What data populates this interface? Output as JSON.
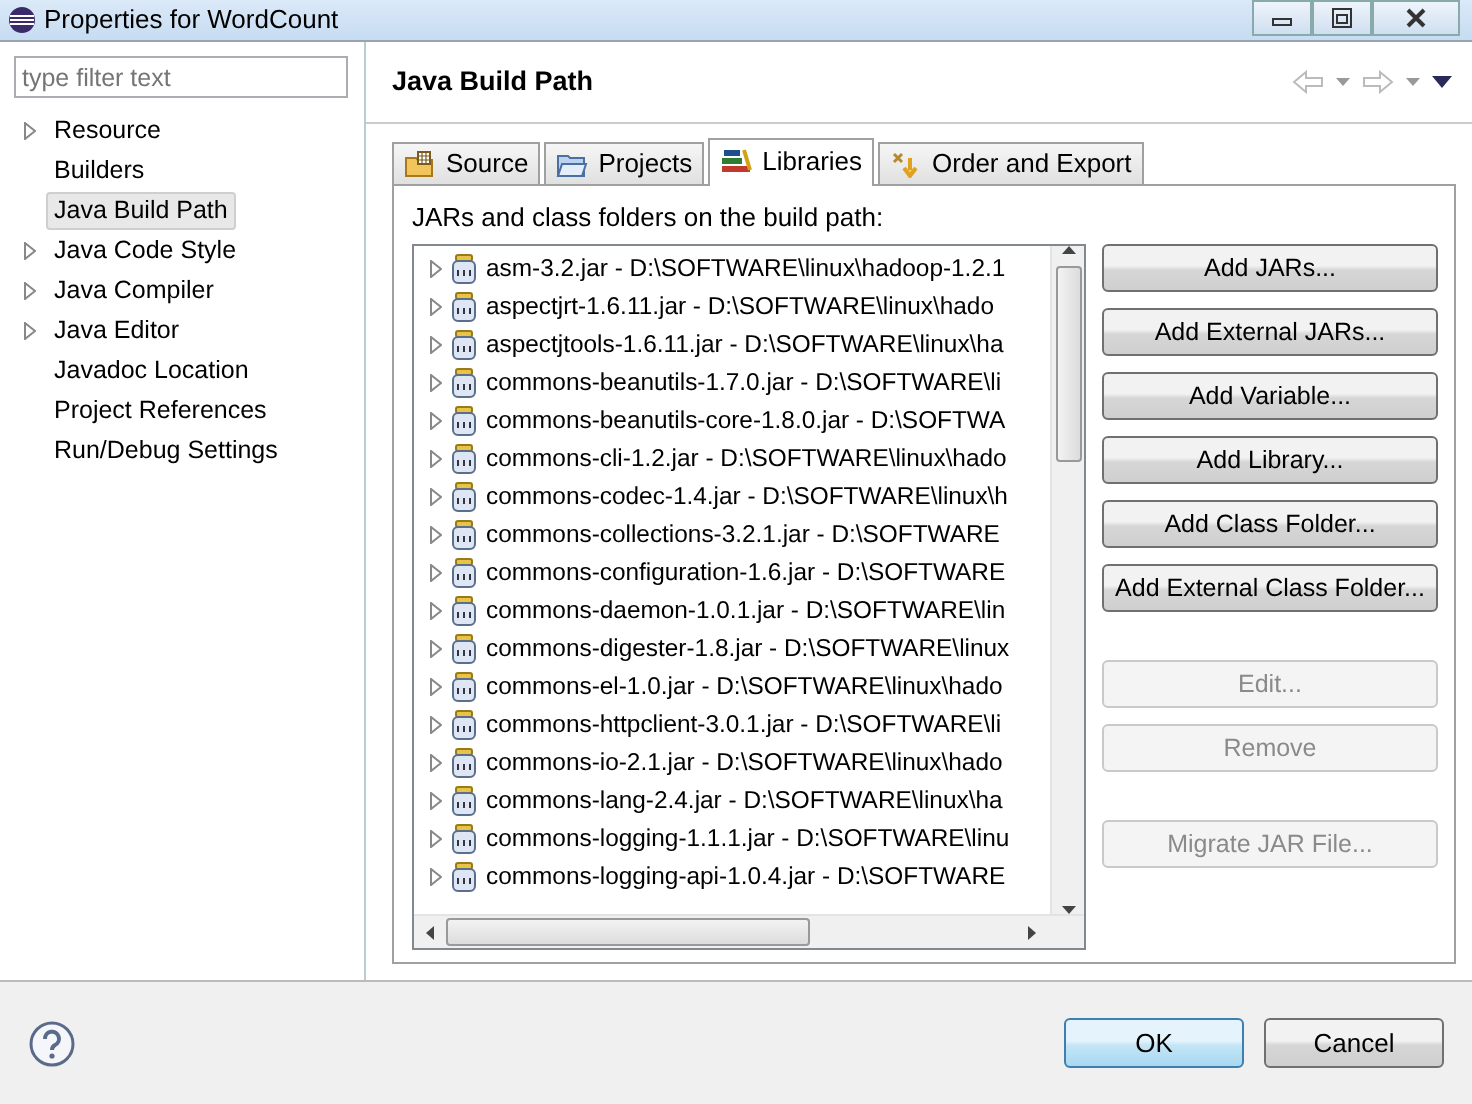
{
  "window": {
    "title": "Properties for WordCount"
  },
  "filter": {
    "placeholder": "type filter text"
  },
  "sidebar": {
    "items": [
      {
        "label": "Resource",
        "expandable": true,
        "selected": false
      },
      {
        "label": "Builders",
        "expandable": false,
        "selected": false
      },
      {
        "label": "Java Build Path",
        "expandable": false,
        "selected": true
      },
      {
        "label": "Java Code Style",
        "expandable": true,
        "selected": false
      },
      {
        "label": "Java Compiler",
        "expandable": true,
        "selected": false
      },
      {
        "label": "Java Editor",
        "expandable": true,
        "selected": false
      },
      {
        "label": "Javadoc Location",
        "expandable": false,
        "selected": false
      },
      {
        "label": "Project References",
        "expandable": false,
        "selected": false
      },
      {
        "label": "Run/Debug Settings",
        "expandable": false,
        "selected": false
      }
    ]
  },
  "page": {
    "title": "Java Build Path"
  },
  "tabs": [
    {
      "label": "Source",
      "kind": "source",
      "selected": false
    },
    {
      "label": "Projects",
      "kind": "projects",
      "selected": false
    },
    {
      "label": "Libraries",
      "kind": "libraries",
      "selected": true
    },
    {
      "label": "Order and Export",
      "kind": "order",
      "selected": false
    }
  ],
  "libraries": {
    "caption": "JARs and class folders on the build path:",
    "items": [
      "asm-3.2.jar - D:\\SOFTWARE\\linux\\hadoop-1.2.1",
      "aspectjrt-1.6.11.jar - D:\\SOFTWARE\\linux\\hado",
      "aspectjtools-1.6.11.jar - D:\\SOFTWARE\\linux\\ha",
      "commons-beanutils-1.7.0.jar - D:\\SOFTWARE\\li",
      "commons-beanutils-core-1.8.0.jar - D:\\SOFTWA",
      "commons-cli-1.2.jar - D:\\SOFTWARE\\linux\\hado",
      "commons-codec-1.4.jar - D:\\SOFTWARE\\linux\\h",
      "commons-collections-3.2.1.jar - D:\\SOFTWARE",
      "commons-configuration-1.6.jar - D:\\SOFTWARE",
      "commons-daemon-1.0.1.jar - D:\\SOFTWARE\\lin",
      "commons-digester-1.8.jar - D:\\SOFTWARE\\linux",
      "commons-el-1.0.jar - D:\\SOFTWARE\\linux\\hado",
      "commons-httpclient-3.0.1.jar - D:\\SOFTWARE\\li",
      "commons-io-2.1.jar - D:\\SOFTWARE\\linux\\hado",
      "commons-lang-2.4.jar - D:\\SOFTWARE\\linux\\ha",
      "commons-logging-1.1.1.jar - D:\\SOFTWARE\\linu",
      "commons-logging-api-1.0.4.jar - D:\\SOFTWARE"
    ]
  },
  "button_groups": [
    [
      {
        "label": "Add JARs...",
        "disabled": false
      },
      {
        "label": "Add External JARs...",
        "disabled": false
      },
      {
        "label": "Add Variable...",
        "disabled": false
      },
      {
        "label": "Add Library...",
        "disabled": false
      },
      {
        "label": "Add Class Folder...",
        "disabled": false
      },
      {
        "label": "Add External Class Folder...",
        "disabled": false
      }
    ],
    [
      {
        "label": "Edit...",
        "disabled": true
      },
      {
        "label": "Remove",
        "disabled": true
      }
    ],
    [
      {
        "label": "Migrate JAR File...",
        "disabled": true
      }
    ]
  ],
  "dialog_buttons": [
    {
      "label": "OK",
      "default": true
    },
    {
      "label": "Cancel",
      "default": false
    }
  ]
}
